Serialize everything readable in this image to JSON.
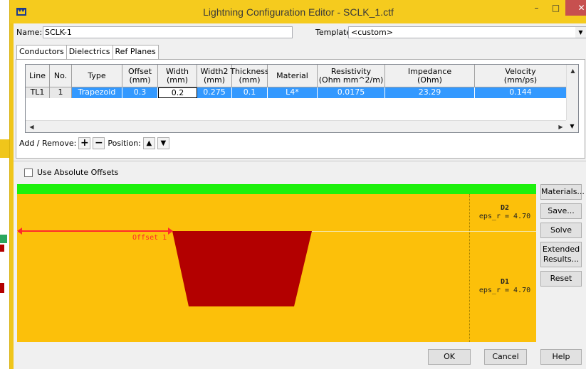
{
  "window": {
    "title": "Lightning Configuration Editor - SCLK_1.ctf",
    "minimize_glyph": "–",
    "maximize_glyph": "□",
    "close_glyph": "✕"
  },
  "name_row": {
    "name_label": "Name:",
    "name_value": "SCLK-1",
    "template_label": "Template:",
    "template_value": "<custom>"
  },
  "tabs": [
    {
      "label": "Conductors"
    },
    {
      "label": "Dielectrics"
    },
    {
      "label": "Ref Planes"
    }
  ],
  "grid": {
    "columns": [
      {
        "label": "Line"
      },
      {
        "label": "No."
      },
      {
        "label": "Type"
      },
      {
        "label": "Offset\n(mm)"
      },
      {
        "label": "Width\n(mm)"
      },
      {
        "label": "Width2\n(mm)"
      },
      {
        "label": "Thickness\n(mm)"
      },
      {
        "label": "Material"
      },
      {
        "label": "Resistivity\n(Ohm mm^2/m)"
      },
      {
        "label": "Impedance\n(Ohm)"
      },
      {
        "label": "Velocity\n(mm/ps)"
      }
    ],
    "rows": [
      {
        "cells": [
          "TL1",
          "1",
          "Trapezoid",
          "0.3",
          "0.2",
          "0.275",
          "0.1",
          "L4*",
          "0.0175",
          "23.29",
          "0.144"
        ]
      }
    ]
  },
  "add_remove": {
    "label": "Add / Remove:",
    "add_glyph": "+",
    "remove_glyph": "−",
    "position_label": "Position:",
    "up_glyph": "▲",
    "down_glyph": "▼"
  },
  "options": {
    "use_absolute_offsets_label": "Use Absolute Offsets",
    "use_absolute_offsets_checked": false
  },
  "stackup": {
    "ref_plane_color": "#1cf00c",
    "dielectric_color": "#fcc00a",
    "conductor_color": "#b30000",
    "offset_color": "#ff2a2a",
    "offset_label": "Offset 1",
    "layers": [
      {
        "name": "D2",
        "eps": "eps_r = 4.70"
      },
      {
        "name": "D1",
        "eps": "eps_r = 4.70"
      }
    ]
  },
  "side_buttons": {
    "materials": "Materials...",
    "save": "Save...",
    "solve": "Solve",
    "extended_line1": "Extended",
    "extended_line2": "Results...",
    "reset": "Reset"
  },
  "bottom_buttons": {
    "ok": "OK",
    "cancel": "Cancel",
    "help": "Help"
  }
}
